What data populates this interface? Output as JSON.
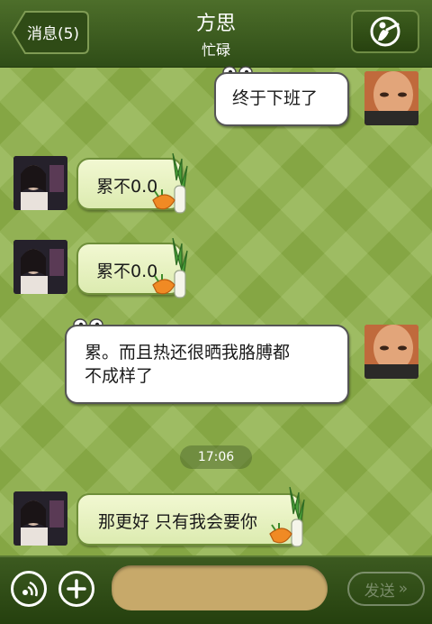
{
  "header": {
    "back_label": "消息(5)",
    "title": "方思",
    "status": "忙碌"
  },
  "messages": [
    {
      "side": "right",
      "text": "终于下班了",
      "sender_avatar": "my-avatar"
    },
    {
      "side": "left",
      "text": "累不0.0",
      "sender_avatar": "contact-avatar"
    },
    {
      "side": "left",
      "text": "累不0.0",
      "sender_avatar": "contact-avatar"
    },
    {
      "side": "right",
      "text_line1": "累。而且热还很晒我胳膊都",
      "text_line2": "不成样了",
      "sender_avatar": "my-avatar"
    },
    {
      "side": "left",
      "text": "那更好 只有我会要你",
      "sender_avatar": "contact-avatar"
    }
  ],
  "timestamp": "17:06",
  "composer": {
    "input_value": "",
    "send_label": "发送"
  },
  "icons": {
    "voice_call": "voice-call-icon",
    "voice_mode": "voice-mode-icon",
    "add": "plus-icon",
    "sticker": "leek-sticker-icon",
    "sweat": "sweat-drops-icon"
  },
  "colors": {
    "header_bg": "#3a5a1d",
    "bubble_left": "#e6f1c0",
    "bubble_right": "#ffffff",
    "input_bg": "#c7a96a"
  }
}
